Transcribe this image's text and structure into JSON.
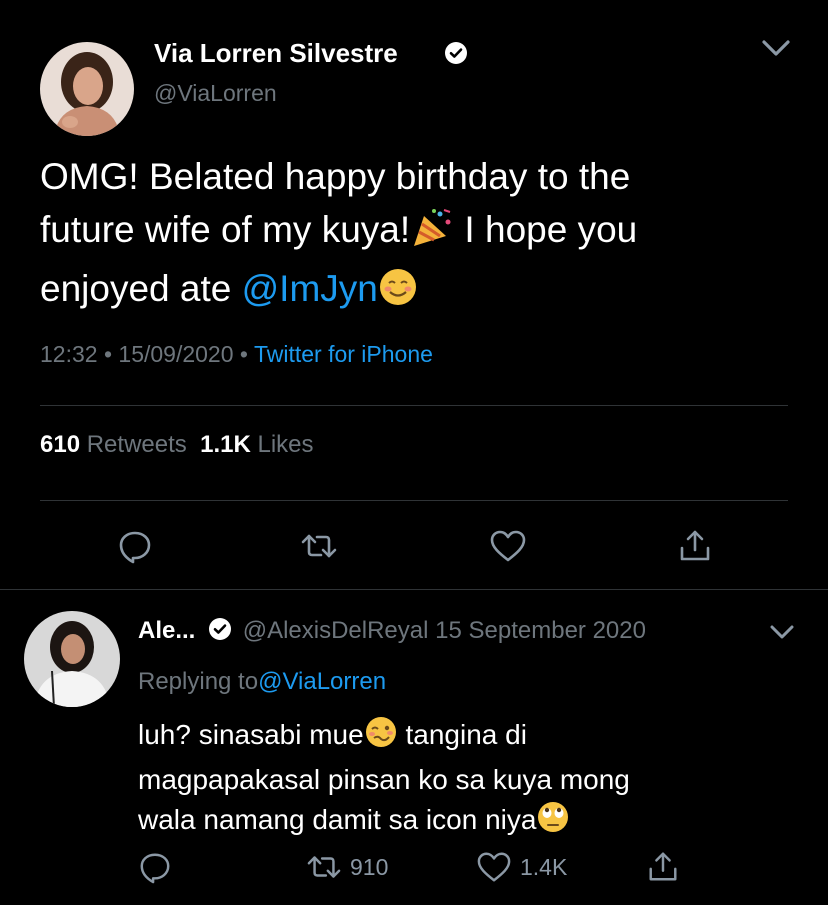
{
  "tweet": {
    "author_name": "Via Lorren Silvestre",
    "author_handle": "@ViaLorren",
    "text_line1": "OMG! Belated happy birthday to the",
    "text_line2a": "future wife of my kuya!",
    "text_line2b": " I hope you",
    "text_line3a": "enjoyed ate ",
    "text_mention": "@ImJyn",
    "time": "12:32",
    "sep1": " • ",
    "date": "15/09/2020",
    "sep2": " • ",
    "source": "Twitter for iPhone",
    "retweets_count": "610",
    "retweets_label": "Retweets",
    "likes_count": "1.1K",
    "likes_label": "Likes"
  },
  "reply": {
    "author_name": "Ale...",
    "author_handle": "@AlexisDelReyal",
    "date": "15 September 2020",
    "replying_prefix": "Replying to",
    "replying_handle": "@ViaLorren",
    "text_line1a": "luh? sinasabi mue",
    "text_line1b": "  tangina di",
    "text_line2": "magpapakasal pinsan ko sa kuya mong",
    "text_line3": "wala namang damit sa icon niya",
    "retweet_count": "910",
    "like_count": "1.4K"
  },
  "icons": {
    "verified": "verified-badge-icon",
    "chevron": "chevron-down-icon",
    "reply": "reply-icon",
    "retweet": "retweet-icon",
    "like": "heart-icon",
    "share": "share-icon"
  },
  "colors": {
    "background": "#000000",
    "accent": "#1d9bf0",
    "muted": "#6e767d",
    "divider": "#2f3336"
  }
}
